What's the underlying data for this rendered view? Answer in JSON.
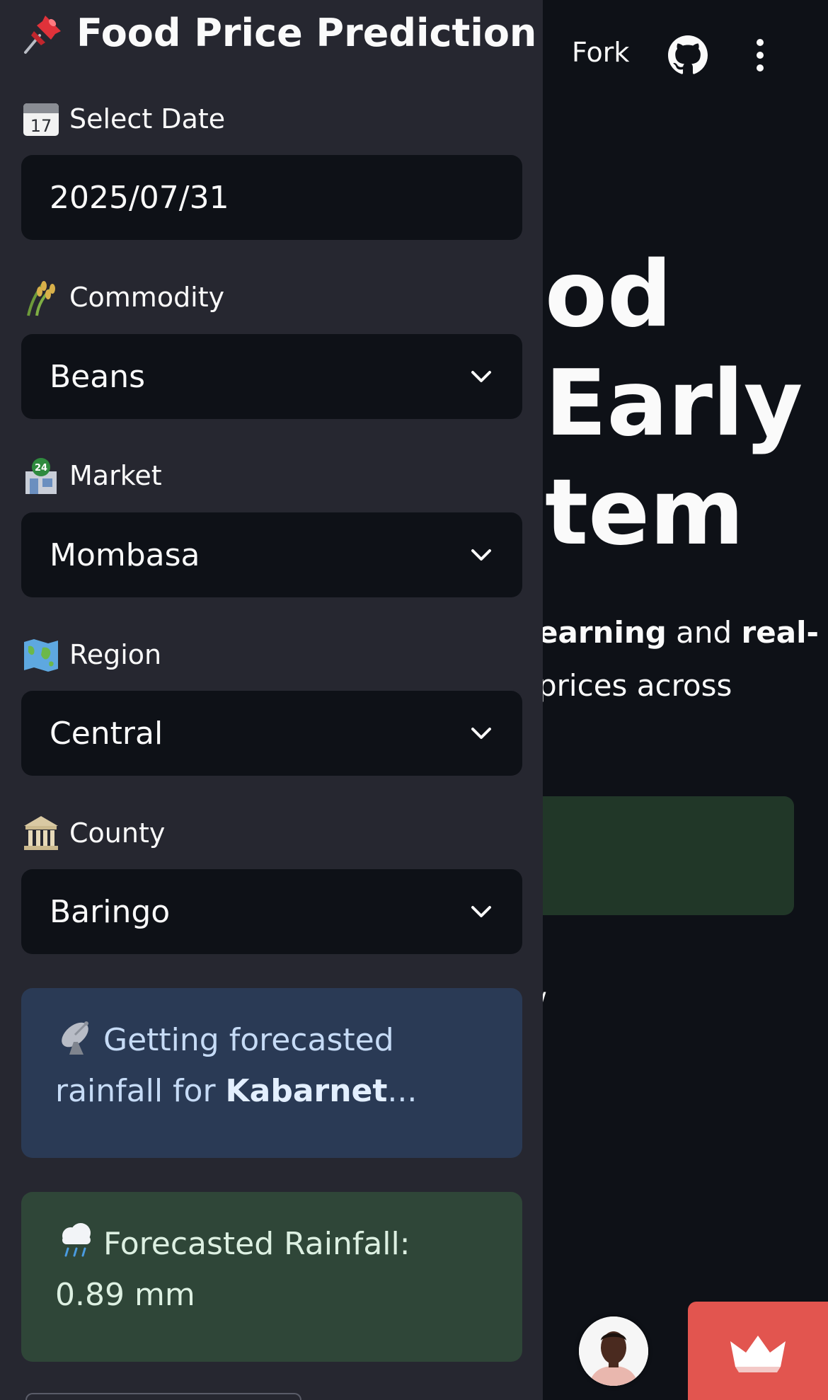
{
  "main": {
    "toolbar": {
      "fork_label": "Fork"
    },
    "hero": {
      "title_line1": "od",
      "title_line2": "Early",
      "title_line3": "tem",
      "body_line1_bold1": "earning",
      "body_line1_mid": " and ",
      "body_line1_bold2": "real-",
      "body_line2": "prices across"
    },
    "stray_text": "/"
  },
  "sidebar": {
    "title": "Food Price Prediction",
    "fields": [
      {
        "label": "Select Date",
        "value": "2025/07/31",
        "icon": "calendar-icon"
      },
      {
        "label": "Commodity",
        "value": "Beans",
        "icon": "rice-sheaf-icon"
      },
      {
        "label": "Market",
        "value": "Mombasa",
        "icon": "convenience-store-icon"
      },
      {
        "label": "Region",
        "value": "Central",
        "icon": "world-map-icon"
      },
      {
        "label": "County",
        "value": "Baringo",
        "icon": "classical-building-icon"
      }
    ],
    "info": {
      "text_before": "Getting forecasted rainfall for ",
      "location": "Kabarnet",
      "text_after": "..."
    },
    "rainfall": {
      "text": "Forecasted Rainfall: 0.89 mm"
    }
  },
  "colors": {
    "app_background": "#0e1117",
    "sidebar_background": "#262730",
    "info_background": "#2a3a55",
    "success_background": "#2f4638",
    "streamlit_badge": "#e2554f"
  }
}
